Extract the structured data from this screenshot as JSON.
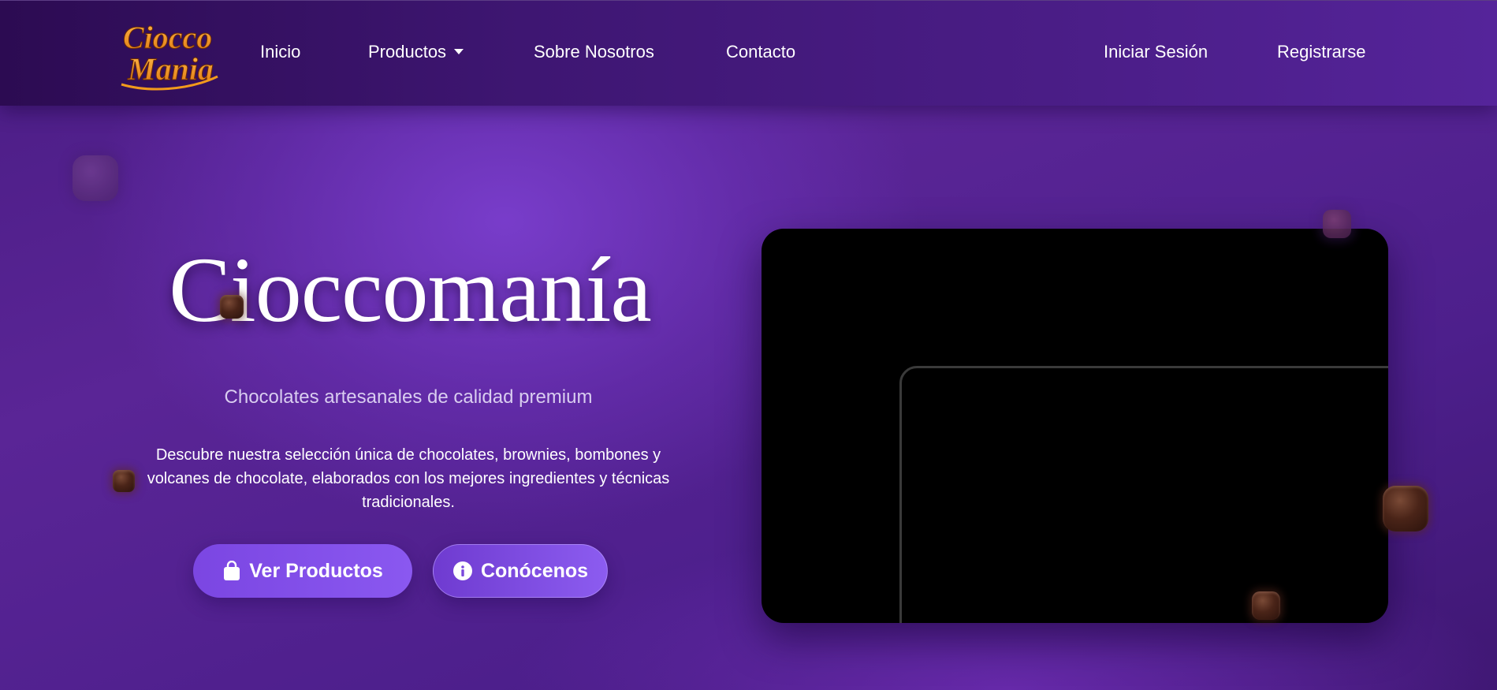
{
  "brand": {
    "logo_line1": "Ciocco",
    "logo_line2": "Mania",
    "logo_color": "#f29a1c"
  },
  "nav": {
    "inicio": "Inicio",
    "productos": "Productos",
    "sobre_nosotros": "Sobre Nosotros",
    "contacto": "Contacto",
    "iniciar_sesion": "Iniciar Sesión",
    "registrarse": "Registrarse"
  },
  "hero": {
    "title": "Cioccomanía",
    "subtitle": "Chocolates artesanales de calidad premium",
    "description": "Descubre nuestra selección única de chocolates, brownies, bombones y volcanes de chocolate, elaborados con los mejores ingredientes y técnicas tradicionales.",
    "primary_button": "Ver Productos",
    "primary_button_icon": "shopping-bag-icon",
    "secondary_button": "Conócenos",
    "secondary_button_icon": "info-circle-icon"
  },
  "video_panel": {
    "background": "#000000"
  },
  "colors": {
    "accent": "#8a58f0",
    "navbar": "#3e1672",
    "background": "#5a2596"
  }
}
